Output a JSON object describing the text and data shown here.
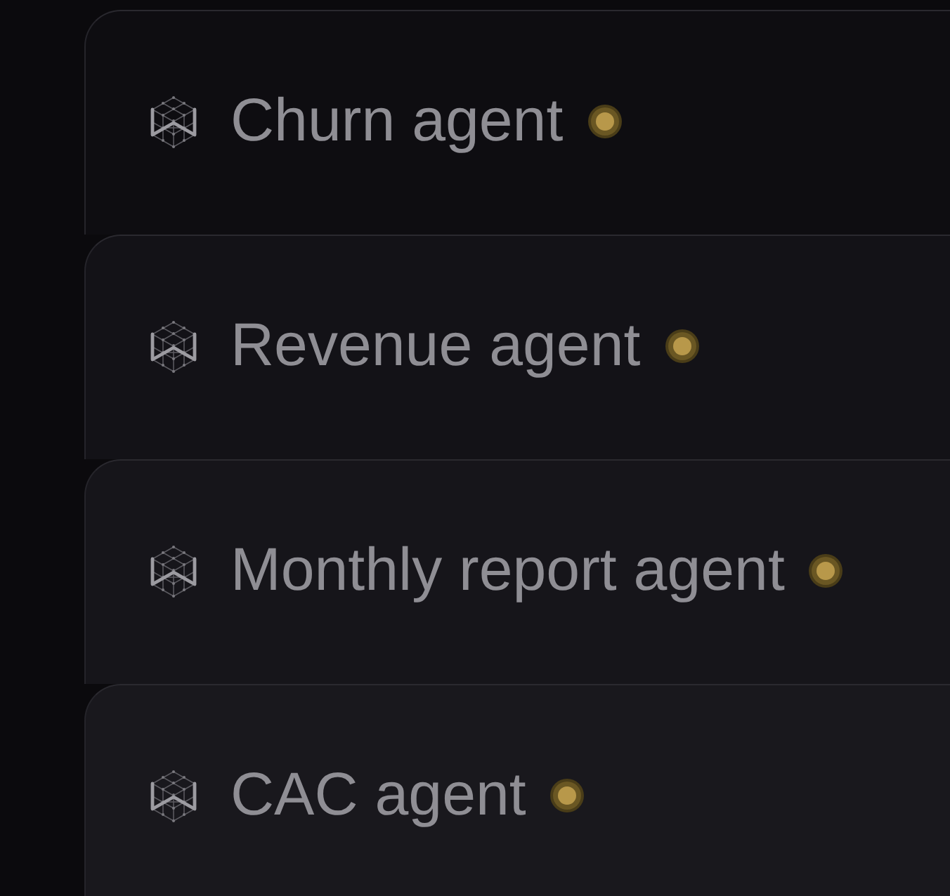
{
  "agents": [
    {
      "name": "Churn agent"
    },
    {
      "name": "Revenue agent"
    },
    {
      "name": "Monthly report agent"
    },
    {
      "name": "CAC agent"
    }
  ]
}
